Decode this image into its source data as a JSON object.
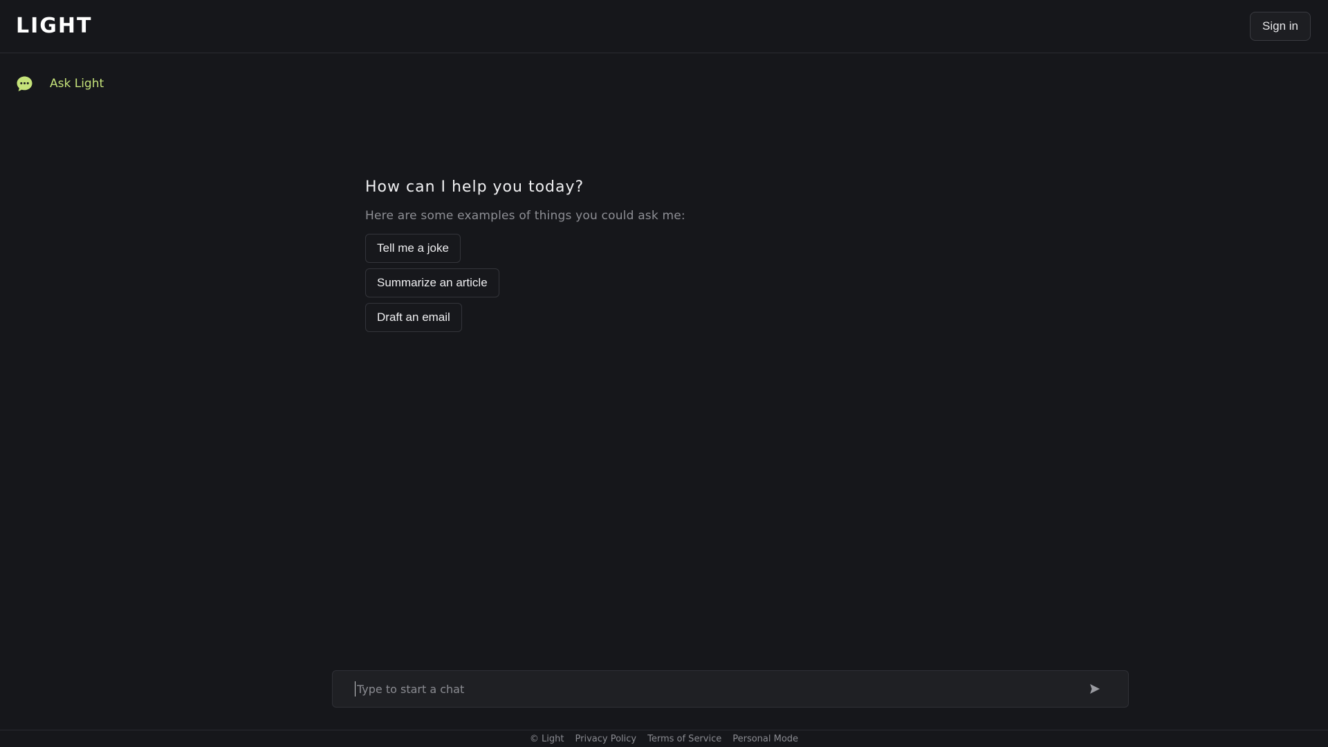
{
  "header": {
    "logo_text": "LIGHT",
    "signin_label": "Sign in"
  },
  "sidebar": {
    "items": [
      {
        "label": "Ask Light",
        "icon": "chat-bubble-icon"
      }
    ]
  },
  "main": {
    "title": "How can I help you today?",
    "subtitle": "Here are some examples of things you could ask me:",
    "examples": [
      {
        "label": "Tell me a joke"
      },
      {
        "label": "Summarize an article"
      },
      {
        "label": "Draft an email"
      }
    ]
  },
  "chat": {
    "placeholder": "Type to start a chat",
    "value": "",
    "send_icon": "send-icon"
  },
  "footer": {
    "copyright": "© Light",
    "links": [
      {
        "label": "Privacy Policy"
      },
      {
        "label": "Terms of Service"
      },
      {
        "label": "Personal Mode"
      }
    ]
  },
  "colors": {
    "background": "#16171b",
    "accent": "#c5e37a",
    "text": "#f0f0f2",
    "muted": "#8e8f95",
    "border": "#34353b"
  }
}
